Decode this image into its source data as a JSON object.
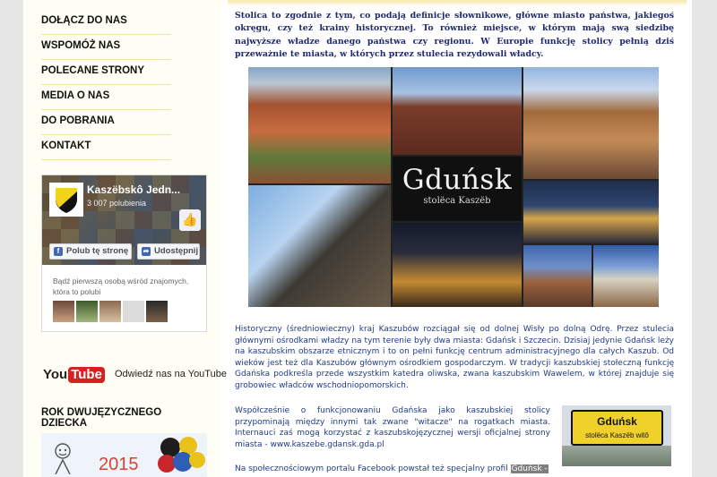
{
  "sidebar": {
    "nav": [
      {
        "label": "DOŁĄCZ DO NAS"
      },
      {
        "label": "WSPOMÓŻ NAS"
      },
      {
        "label": "POLECANE STRONY"
      },
      {
        "label": "MEDIA O NAS"
      },
      {
        "label": "DO POBRANIA"
      },
      {
        "label": "KONTAKT"
      }
    ],
    "facebook": {
      "page_name": "Kaszëbskô Jedn...",
      "likes": "3 007 polubienia",
      "like_button": "Polub tę stronę",
      "share_button": "Udostępnij",
      "message": "Bądź pierwszą osobą wśród znajomych, która to polubi"
    },
    "youtube": {
      "logo_you": "You",
      "logo_tube": "Tube",
      "link_text": "Odwiedź nas na YouTube"
    },
    "section_heading": "ROK DWUJĘZYCZNEGO DZIECKA",
    "banner_year": "2015"
  },
  "main": {
    "intro": "Stolica to zgodnie z tym, co podają definicje słownikowe, główne miasto państwa, jakiegoś okręgu, czy też krainy historycznej. To również miejsce, w którym mają swą siedzibę najwyższe władze danego państwa czy regionu. W Europie funkcję stolicy pełnią dziś przeważnie te miasta, w których przez stulecia rezydowali władcy.",
    "collage": {
      "title": "Gduńsk",
      "subtitle": "stolëca Kaszëb"
    },
    "paragraph1": "Historyczny (średniowieczny) kraj Kaszubów rozciągał się od dolnej Wisły po dolną Odrę. Przez stulecia głównymi ośrodkami władzy na tym terenie były dwa miasta: Gdańsk i Szczecin. Dzisiaj jedynie Gdańsk leży na kaszubskim obszarze etnicznym i to on pełni funkcję centrum administracyjnego dla całych Kaszub. Od wieków jest też dla Kaszubów głównym ośrodkiem gospodarczym. W tradycji kaszubskiej stołeczną funkcję Gdańska podkreśla przede wszystkim katedra oliwska, zwana kaszubskim Wawelem, w której znajduje się grobowiec władców wschodniopomorskich.",
    "paragraph2_text": "Współcześnie o funkcjonowaniu Gdańska jako kaszubskiej stolicy przypominają między innymi tak zwane \"witacze\" na rogatkach miasta. Internauci zaś mogą korzystać z kaszubskojęzycznej wersji oficjalnej strony miasta - ",
    "paragraph2_link": "www.kaszebe.gdansk.gda.pl",
    "paragraph3_text": "Na społecznościowym portalu Facebook powstał też specjalny profil ",
    "paragraph3_highlight": "Gduńsk -",
    "sign": {
      "line1": "Gduńsk",
      "line2": "stolëca Kaszëb witô"
    }
  },
  "colors": {
    "sidebar_bg": "#fffef4",
    "nav_divider": "#efe3a8",
    "intro_text": "#1f2a70",
    "body_text": "#1f3a8a",
    "facebook_blue": "#4267b2",
    "youtube_red": "#d6211f",
    "sign_yellow": "#f0d12a"
  },
  "icons": [
    "facebook-f-icon",
    "share-icon",
    "thumbs-up-icon",
    "youtube-logo",
    "coat-of-arms-icon"
  ]
}
